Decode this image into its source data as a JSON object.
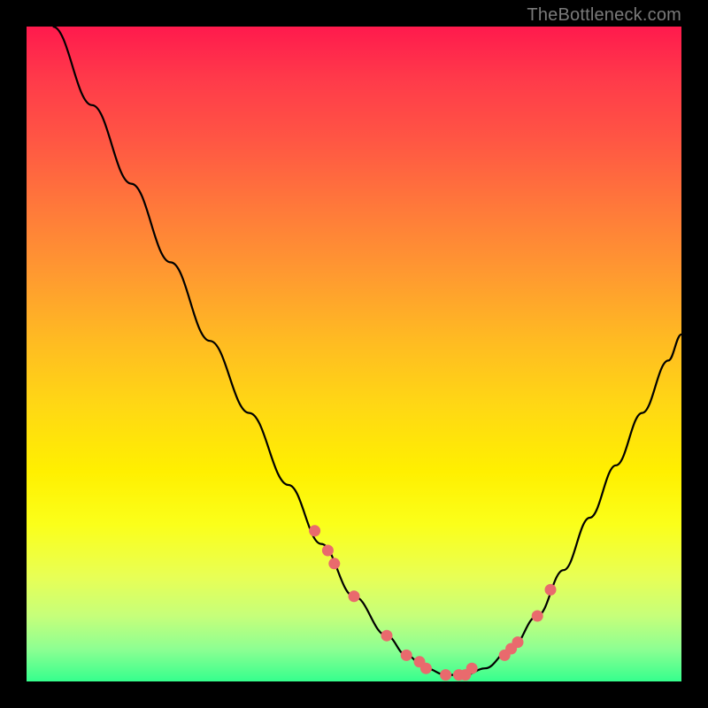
{
  "attribution": "TheBottleneck.com",
  "colors": {
    "page_bg": "#000000",
    "curve": "#000000",
    "marker_fill": "#e96a6d",
    "marker_stroke": "#d34e55"
  },
  "chart_data": {
    "type": "line",
    "title": "",
    "xlabel": "",
    "ylabel": "",
    "xlim": [
      0,
      100
    ],
    "ylim": [
      0,
      100
    ],
    "grid": false,
    "legend": false,
    "series": [
      {
        "name": "bottleneck-curve",
        "x": [
          4,
          10,
          16,
          22,
          28,
          34,
          40,
          45,
          50,
          55,
          58,
          61,
          64,
          67,
          70,
          74,
          78,
          82,
          86,
          90,
          94,
          98,
          100
        ],
        "y": [
          100,
          88,
          76,
          64,
          52,
          41,
          30,
          21,
          13,
          7,
          4,
          2,
          1,
          1,
          2,
          5,
          10,
          17,
          25,
          33,
          41,
          49,
          53
        ]
      }
    ],
    "markers": {
      "name": "highlight-points",
      "x": [
        44,
        46,
        47,
        50,
        55,
        58,
        60,
        61,
        64,
        66,
        67,
        68,
        73,
        74,
        75,
        78,
        80
      ],
      "y": [
        23,
        20,
        18,
        13,
        7,
        4,
        3,
        2,
        1,
        1,
        1,
        2,
        4,
        5,
        6,
        10,
        14
      ]
    }
  }
}
